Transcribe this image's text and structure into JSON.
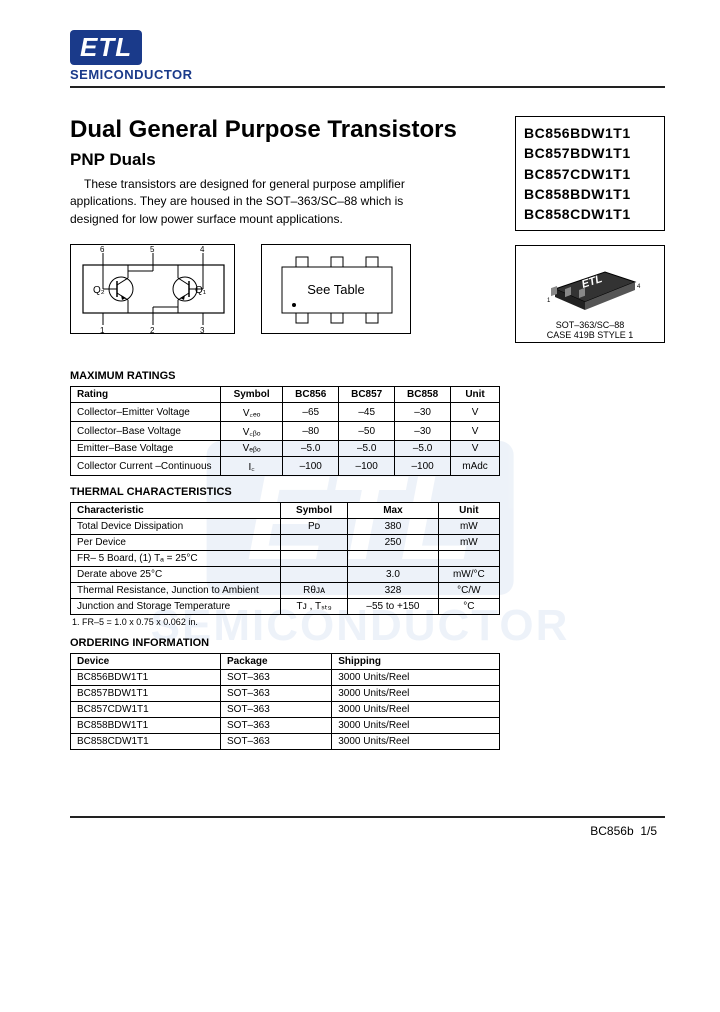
{
  "logo": {
    "brand": "ETL",
    "sub": "SEMICONDUCTOR"
  },
  "title": "Dual General Purpose Transistors",
  "subtitle": "PNP  Duals",
  "description": "These transistors are designed for general purpose amplifier applications. They are housed in the SOT–363/SC–88 which is designed for low power surface mount applications.",
  "part_numbers": [
    "BC856BDW1T1",
    "BC857BDW1T1",
    "BC857CDW1T1",
    "BC858BDW1T1",
    "BC858CDW1T1"
  ],
  "package_info": {
    "line1": "SOT–363/SC–88",
    "line2": "CASE 419B STYLE 1"
  },
  "schematic": {
    "q1": "Q₁",
    "q2": "Q₂",
    "pins": [
      "1",
      "2",
      "3",
      "4",
      "5",
      "6"
    ]
  },
  "see_table": "See Table",
  "sections": {
    "max": "MAXIMUM RATINGS",
    "thermal": "THERMAL CHARACTERISTICS",
    "ordering": "ORDERING INFORMATION"
  },
  "max_ratings": {
    "headers": [
      "Rating",
      "Symbol",
      "BC856",
      "BC857",
      "BC858",
      "Unit"
    ],
    "rows": [
      [
        "Collector–Emitter Voltage",
        "V꜀ₑₒ",
        "–65",
        "–45",
        "–30",
        "V"
      ],
      [
        "Collector–Base Voltage",
        "V꜀ᵦₒ",
        "–80",
        "–50",
        "–30",
        "V"
      ],
      [
        "Emitter–Base Voltage",
        "Vₑᵦₒ",
        "–5.0",
        "–5.0",
        "–5.0",
        "V"
      ],
      [
        "Collector Current –Continuous",
        "I꜀",
        "–100",
        "–100",
        "–100",
        "mAdc"
      ]
    ]
  },
  "thermal": {
    "headers": [
      "Characteristic",
      "Symbol",
      "Max",
      "Unit"
    ],
    "rows": [
      [
        "Total Device Dissipation",
        "Pᴅ",
        "380",
        "mW"
      ],
      [
        "Per Device",
        "",
        "250",
        "mW"
      ],
      [
        "FR– 5 Board, (1)  Tₐ = 25°C",
        "",
        "",
        ""
      ],
      [
        "Derate above 25°C",
        "",
        "3.0",
        "mW/°C"
      ],
      [
        "Thermal Resistance, Junction to Ambient",
        "Rθᴊᴀ",
        "328",
        "°C/W"
      ],
      [
        "Junction and Storage Temperature",
        "Tᴊ , Tₛₜ₉",
        "–55 to +150",
        "°C"
      ]
    ],
    "footnote": "1. FR–5 = 1.0 x 0.75 x 0.062 in."
  },
  "ordering": {
    "headers": [
      "Device",
      "Package",
      "Shipping"
    ],
    "rows": [
      [
        "BC856BDW1T1",
        "SOT–363",
        "3000 Units/Reel"
      ],
      [
        "BC857BDW1T1",
        "SOT–363",
        "3000 Units/Reel"
      ],
      [
        "BC857CDW1T1",
        "SOT–363",
        "3000 Units/Reel"
      ],
      [
        "BC858BDW1T1",
        "SOT–363",
        "3000 Units/Reel"
      ],
      [
        "BC858CDW1T1",
        "SOT–363",
        "3000 Units/Reel"
      ]
    ]
  },
  "footer": {
    "doc": "BC856b",
    "page": "1/5"
  }
}
